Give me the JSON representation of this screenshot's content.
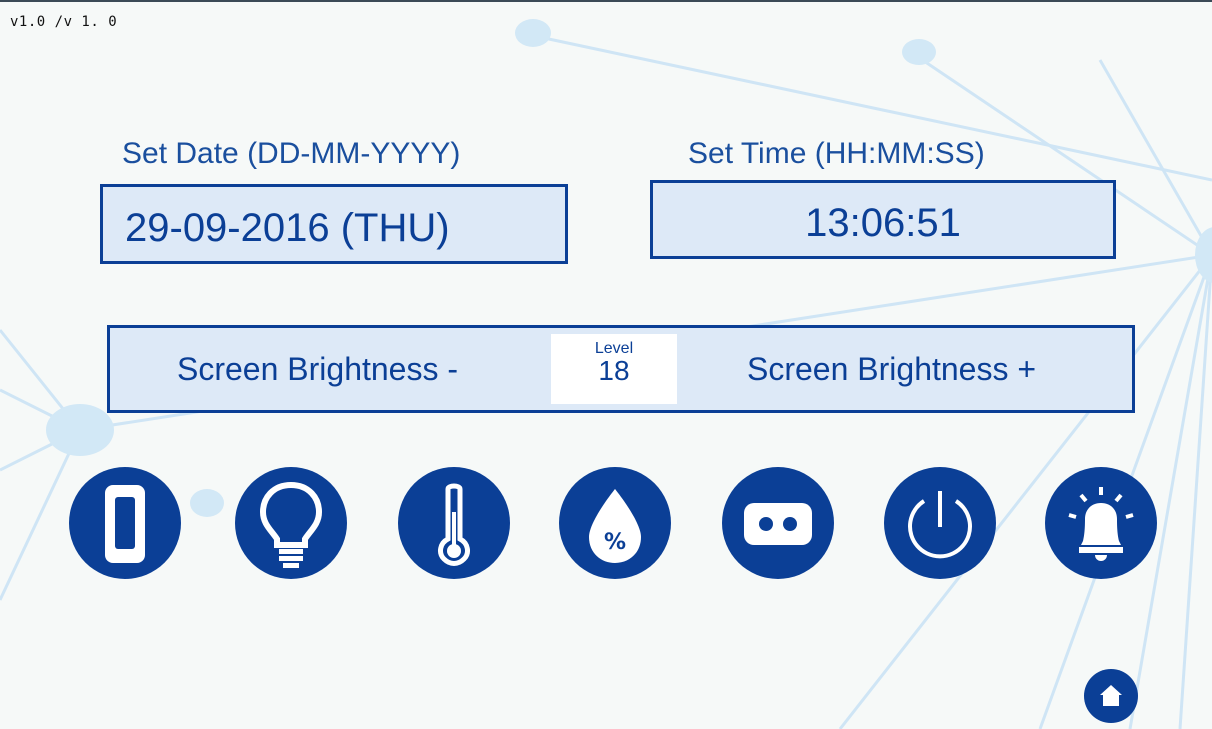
{
  "version": "v1.0 /v 1. 0",
  "date": {
    "label": "Set Date (DD-MM-YYYY)",
    "value": "29-09-2016 (THU)"
  },
  "time": {
    "label": "Set Time (HH:MM:SS)",
    "value": "13:06:51"
  },
  "brightness": {
    "decrease_label": "Screen Brightness -",
    "increase_label": "Screen Brightness +",
    "level_label": "Level",
    "level_value": "18"
  },
  "icons": [
    {
      "name": "battery-icon"
    },
    {
      "name": "lightbulb-icon"
    },
    {
      "name": "thermometer-icon"
    },
    {
      "name": "humidity-icon"
    },
    {
      "name": "cassette-icon"
    },
    {
      "name": "power-icon"
    },
    {
      "name": "alarm-bell-icon"
    },
    {
      "name": "home-icon"
    }
  ],
  "colors": {
    "primary": "#0b3f96",
    "field_background": "#dde9f7",
    "page_background": "#f6f9f8",
    "decor": "#d2e8f6"
  }
}
